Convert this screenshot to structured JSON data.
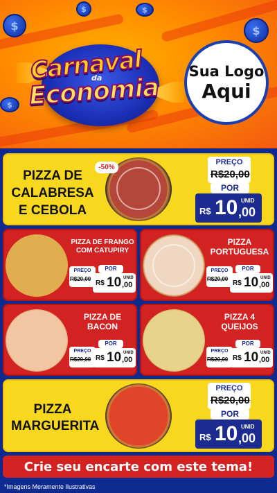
{
  "header": {
    "title_line1": "Carnaval",
    "title_small": "da",
    "title_line2": "Economia",
    "logo_line1": "Sua Logo",
    "logo_line2": "Aqui"
  },
  "price_labels": {
    "preco": "PREÇO",
    "por": "POR",
    "currency": "R$",
    "unit": "UNID"
  },
  "products": [
    {
      "name": "PIZZA DE CALABRESA E CEBOLA",
      "badge": "-50%",
      "old_price": "R$20,00",
      "price_int": "10",
      "price_dec": ",00"
    },
    {
      "name": "PIZZA DE FRANGO COM CATUPIRY",
      "old_price": "R$20,00",
      "price_int": "10",
      "price_dec": ",00"
    },
    {
      "name": "PIZZA PORTUGUESA",
      "old_price": "R$20,00",
      "price_int": "10",
      "price_dec": ",00"
    },
    {
      "name": "PIZZA DE BACON",
      "old_price": "R$20,00",
      "price_int": "10",
      "price_dec": ",00"
    },
    {
      "name": "PIZZA 4 QUEIJOS",
      "old_price": "R$20,00",
      "price_int": "10",
      "price_dec": ",00"
    },
    {
      "name": "PIZZA MARGUERITA",
      "old_price": "R$20,00",
      "price_int": "10",
      "price_dec": ",00"
    }
  ],
  "cta": "Crie seu encarte com este tema!",
  "footer_note": "*Imagens Meramente Ilustrativas",
  "colors": {
    "blue": "#0f2a8f",
    "yellow": "#f7d81f",
    "red": "#d32222",
    "orange": "#ff8a00"
  }
}
